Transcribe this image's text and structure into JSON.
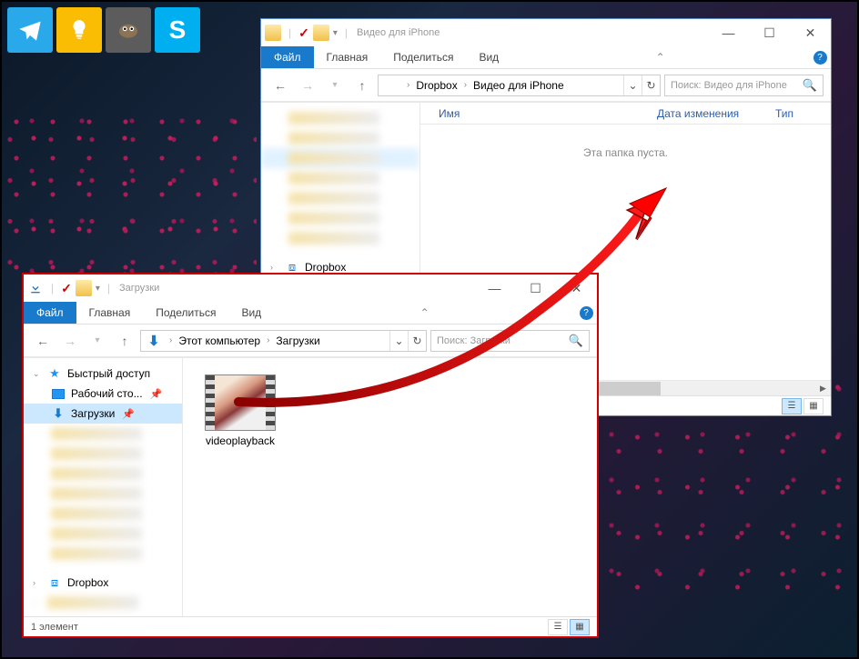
{
  "taskbar": {
    "items": [
      {
        "name": "telegram-icon"
      },
      {
        "name": "tips-icon"
      },
      {
        "name": "gimp-icon"
      },
      {
        "name": "skype-icon",
        "glyph": "S"
      }
    ]
  },
  "window_back": {
    "title": "Видео для iPhone",
    "tabs": {
      "file": "Файл",
      "home": "Главная",
      "share": "Поделиться",
      "view": "Вид"
    },
    "breadcrumbs": [
      "Dropbox",
      "Видео для iPhone"
    ],
    "search_placeholder": "Поиск: Видео для iPhone",
    "columns": {
      "name": "Имя",
      "date": "Дата изменения",
      "type": "Тип"
    },
    "empty_message": "Эта папка пуста.",
    "sidebar": {
      "dropbox": "Dropbox"
    }
  },
  "window_front": {
    "title": "Загрузки",
    "tabs": {
      "file": "Файл",
      "home": "Главная",
      "share": "Поделиться",
      "view": "Вид"
    },
    "breadcrumbs": [
      "Этот компьютер",
      "Загрузки"
    ],
    "search_placeholder": "Поиск: Загрузки",
    "sidebar": {
      "quick_access": "Быстрый доступ",
      "desktop": "Рабочий сто...",
      "downloads": "Загрузки",
      "dropbox": "Dropbox"
    },
    "file": {
      "name": "videoplayback"
    },
    "status": "1 элемент"
  }
}
